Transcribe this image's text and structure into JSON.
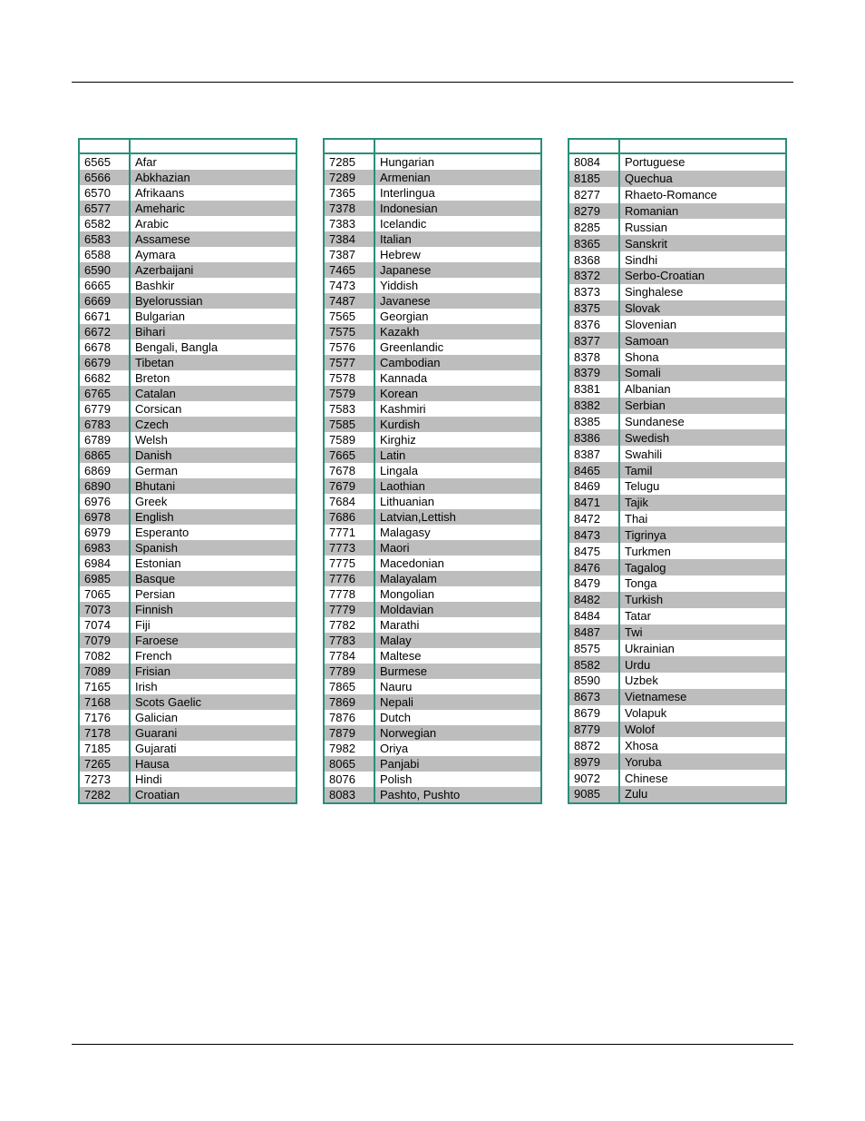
{
  "columns": [
    [
      {
        "code": "6565",
        "name": "Afar"
      },
      {
        "code": "6566",
        "name": "Abkhazian"
      },
      {
        "code": "6570",
        "name": "Afrikaans"
      },
      {
        "code": "6577",
        "name": "Ameharic"
      },
      {
        "code": "6582",
        "name": "Arabic"
      },
      {
        "code": "6583",
        "name": "Assamese"
      },
      {
        "code": "6588",
        "name": "Aymara"
      },
      {
        "code": "6590",
        "name": "Azerbaijani"
      },
      {
        "code": "6665",
        "name": "Bashkir"
      },
      {
        "code": "6669",
        "name": "Byelorussian"
      },
      {
        "code": "6671",
        "name": "Bulgarian"
      },
      {
        "code": "6672",
        "name": "Bihari"
      },
      {
        "code": "6678",
        "name": "Bengali, Bangla"
      },
      {
        "code": "6679",
        "name": "Tibetan"
      },
      {
        "code": "6682",
        "name": "Breton"
      },
      {
        "code": "6765",
        "name": "Catalan"
      },
      {
        "code": "6779",
        "name": "Corsican"
      },
      {
        "code": "6783",
        "name": "Czech"
      },
      {
        "code": "6789",
        "name": "Welsh"
      },
      {
        "code": "6865",
        "name": "Danish"
      },
      {
        "code": "6869",
        "name": "German"
      },
      {
        "code": "6890",
        "name": "Bhutani"
      },
      {
        "code": "6976",
        "name": "Greek"
      },
      {
        "code": "6978",
        "name": "English"
      },
      {
        "code": "6979",
        "name": "Esperanto"
      },
      {
        "code": "6983",
        "name": "Spanish"
      },
      {
        "code": "6984",
        "name": "Estonian"
      },
      {
        "code": "6985",
        "name": "Basque"
      },
      {
        "code": "7065",
        "name": "Persian"
      },
      {
        "code": "7073",
        "name": "Finnish"
      },
      {
        "code": "7074",
        "name": "Fiji"
      },
      {
        "code": "7079",
        "name": "Faroese"
      },
      {
        "code": "7082",
        "name": "French"
      },
      {
        "code": "7089",
        "name": "Frisian"
      },
      {
        "code": "7165",
        "name": "Irish"
      },
      {
        "code": "7168",
        "name": "Scots Gaelic"
      },
      {
        "code": "7176",
        "name": "Galician"
      },
      {
        "code": "7178",
        "name": "Guarani"
      },
      {
        "code": "7185",
        "name": "Gujarati"
      },
      {
        "code": "7265",
        "name": "Hausa"
      },
      {
        "code": "7273",
        "name": "Hindi"
      },
      {
        "code": "7282",
        "name": "Croatian"
      }
    ],
    [
      {
        "code": "7285",
        "name": "Hungarian"
      },
      {
        "code": "7289",
        "name": "Armenian"
      },
      {
        "code": "7365",
        "name": "Interlingua"
      },
      {
        "code": "7378",
        "name": "Indonesian"
      },
      {
        "code": "7383",
        "name": "Icelandic"
      },
      {
        "code": "7384",
        "name": "Italian"
      },
      {
        "code": "7387",
        "name": "Hebrew"
      },
      {
        "code": "7465",
        "name": "Japanese"
      },
      {
        "code": "7473",
        "name": "Yiddish"
      },
      {
        "code": "7487",
        "name": "Javanese"
      },
      {
        "code": "7565",
        "name": "Georgian"
      },
      {
        "code": "7575",
        "name": "Kazakh"
      },
      {
        "code": "7576",
        "name": "Greenlandic"
      },
      {
        "code": "7577",
        "name": "Cambodian"
      },
      {
        "code": "7578",
        "name": "Kannada"
      },
      {
        "code": "7579",
        "name": "Korean"
      },
      {
        "code": "7583",
        "name": "Kashmiri"
      },
      {
        "code": "7585",
        "name": "Kurdish"
      },
      {
        "code": "7589",
        "name": "Kirghiz"
      },
      {
        "code": "7665",
        "name": "Latin"
      },
      {
        "code": "7678",
        "name": "Lingala"
      },
      {
        "code": "7679",
        "name": "Laothian"
      },
      {
        "code": "7684",
        "name": "Lithuanian"
      },
      {
        "code": "7686",
        "name": "Latvian,Lettish"
      },
      {
        "code": "7771",
        "name": "Malagasy"
      },
      {
        "code": "7773",
        "name": "Maori"
      },
      {
        "code": "7775",
        "name": "Macedonian"
      },
      {
        "code": "7776",
        "name": "Malayalam"
      },
      {
        "code": "7778",
        "name": "Mongolian"
      },
      {
        "code": "7779",
        "name": "Moldavian"
      },
      {
        "code": "7782",
        "name": "Marathi"
      },
      {
        "code": "7783",
        "name": "Malay"
      },
      {
        "code": "7784",
        "name": "Maltese"
      },
      {
        "code": "7789",
        "name": "Burmese"
      },
      {
        "code": "7865",
        "name": "Nauru"
      },
      {
        "code": "7869",
        "name": "Nepali"
      },
      {
        "code": "7876",
        "name": "Dutch"
      },
      {
        "code": "7879",
        "name": "Norwegian"
      },
      {
        "code": "7982",
        "name": "Oriya"
      },
      {
        "code": "8065",
        "name": "Panjabi"
      },
      {
        "code": "8076",
        "name": "Polish"
      },
      {
        "code": "8083",
        "name": "Pashto, Pushto"
      }
    ],
    [
      {
        "code": "8084",
        "name": "Portuguese"
      },
      {
        "code": "8185",
        "name": "Quechua"
      },
      {
        "code": "8277",
        "name": "Rhaeto-Romance"
      },
      {
        "code": "8279",
        "name": "Romanian"
      },
      {
        "code": "8285",
        "name": "Russian"
      },
      {
        "code": "8365",
        "name": "Sanskrit"
      },
      {
        "code": "8368",
        "name": "Sindhi"
      },
      {
        "code": "8372",
        "name": "Serbo-Croatian"
      },
      {
        "code": "8373",
        "name": "Singhalese"
      },
      {
        "code": "8375",
        "name": "Slovak"
      },
      {
        "code": "8376",
        "name": "Slovenian"
      },
      {
        "code": "8377",
        "name": "Samoan"
      },
      {
        "code": "8378",
        "name": "Shona"
      },
      {
        "code": "8379",
        "name": "Somali"
      },
      {
        "code": "8381",
        "name": "Albanian"
      },
      {
        "code": "8382",
        "name": "Serbian"
      },
      {
        "code": "8385",
        "name": "Sundanese"
      },
      {
        "code": "8386",
        "name": "Swedish"
      },
      {
        "code": "8387",
        "name": "Swahili"
      },
      {
        "code": "8465",
        "name": "Tamil"
      },
      {
        "code": "8469",
        "name": "Telugu"
      },
      {
        "code": "8471",
        "name": "Tajik"
      },
      {
        "code": "8472",
        "name": "Thai"
      },
      {
        "code": "8473",
        "name": "Tigrinya"
      },
      {
        "code": "8475",
        "name": "Turkmen"
      },
      {
        "code": "8476",
        "name": "Tagalog"
      },
      {
        "code": "8479",
        "name": "Tonga"
      },
      {
        "code": "8482",
        "name": "Turkish"
      },
      {
        "code": "8484",
        "name": "Tatar"
      },
      {
        "code": "8487",
        "name": "Twi"
      },
      {
        "code": "8575",
        "name": "Ukrainian"
      },
      {
        "code": "8582",
        "name": "Urdu"
      },
      {
        "code": "8590",
        "name": "Uzbek"
      },
      {
        "code": "8673",
        "name": "Vietnamese"
      },
      {
        "code": "8679",
        "name": "Volapuk"
      },
      {
        "code": "8779",
        "name": "Wolof"
      },
      {
        "code": "8872",
        "name": "Xhosa"
      },
      {
        "code": "8979",
        "name": "Yoruba"
      },
      {
        "code": "9072",
        "name": "Chinese"
      },
      {
        "code": "9085",
        "name": "Zulu"
      }
    ]
  ]
}
